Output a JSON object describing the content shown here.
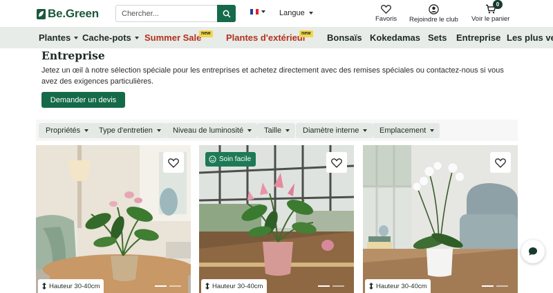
{
  "brand": {
    "name": "Be.Green",
    "color": "#1a5a3c"
  },
  "search": {
    "placeholder": "Chercher..."
  },
  "language": {
    "flag": "FR",
    "label": "Langue"
  },
  "header_actions": {
    "favorites": "Favoris",
    "club": "Rejoindre le club",
    "cart": "Voir le panier",
    "cart_count": "0"
  },
  "nav": {
    "items": [
      {
        "label": "Plantes",
        "dropdown": true
      },
      {
        "label": "Cache-pots",
        "dropdown": true
      },
      {
        "label": "Summer Sale",
        "badge": "new"
      },
      {
        "label": "Plantes d'extérieur",
        "badge": "new"
      },
      {
        "label": "Bonsaïs"
      },
      {
        "label": "Kokedamas"
      },
      {
        "label": "Sets"
      },
      {
        "label": "Entreprise"
      },
      {
        "label": "Les plus vendus"
      }
    ]
  },
  "page": {
    "title": "Entreprise",
    "description": "Jetez un œil à notre sélection spéciale pour les entreprises et achetez directement avec des remises spéciales ou contactez-nous si vous avez des exigences particulières.",
    "cta": "Demander un devis"
  },
  "filters": [
    "Propriétés",
    "Type d'entretien",
    "Niveau de luminosité",
    "Taille",
    "Diamètre interne",
    "Emplacement"
  ],
  "products": [
    {
      "height": "Hauteur 30-40cm",
      "badge": ""
    },
    {
      "height": "Hauteur 30-40cm",
      "badge": "Soin facile"
    },
    {
      "height": "Hauteur 30-40cm",
      "badge": ""
    }
  ],
  "colors": {
    "primary": "#156a4a",
    "nav_bg": "#e7ece8",
    "sale_red": "#b42f1f",
    "new_badge": "#f1d64a"
  }
}
